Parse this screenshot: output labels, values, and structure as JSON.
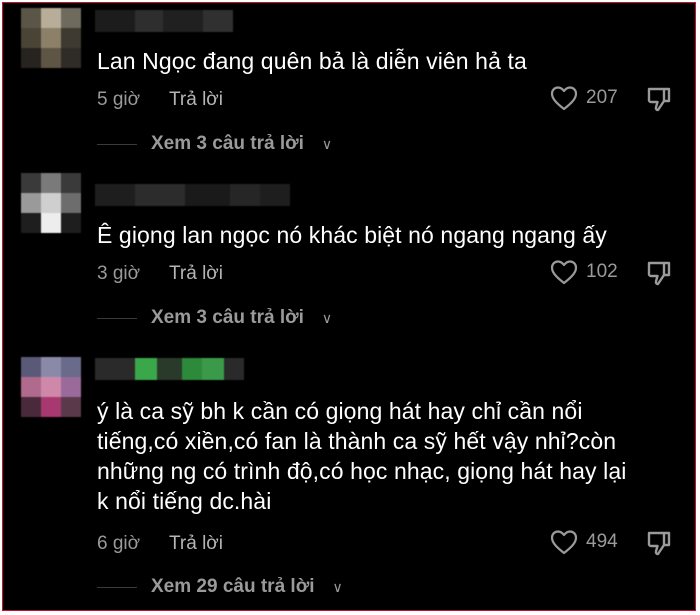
{
  "comments": [
    {
      "text": "Lan Ngọc đang quên bả là diễn viên hả ta",
      "time": "5 giờ",
      "reply_label": "Trả lời",
      "likes": "207",
      "view_replies": "Xem 3 câu trả lời"
    },
    {
      "text": "Ê giọng lan ngọc nó khác biệt nó ngang ngang ấy",
      "time": "3 giờ",
      "reply_label": "Trả lời",
      "likes": "102",
      "view_replies": "Xem 3 câu trả lời"
    },
    {
      "text_lines": [
        "ý là ca sỹ bh k cần có giọng hát hay chỉ cần nổi",
        "tiếng,có xiền,có fan là thành ca sỹ hết vậy nhỉ?còn",
        "những ng có trình độ,có học nhạc, giọng hát hay lại",
        "k nổi tiếng dc.hài"
      ],
      "time": "6 giờ",
      "reply_label": "Trả lời",
      "likes": "494",
      "view_replies": "Xem 29 câu trả lời"
    }
  ],
  "colors": {
    "background": "#000000",
    "text": "#ffffff",
    "muted": "#9a9a9a",
    "border": "#c8102e"
  },
  "icons": {
    "like": "heart-outline-icon",
    "dislike": "thumbs-down-icon",
    "expand": "chevron-down-icon"
  }
}
